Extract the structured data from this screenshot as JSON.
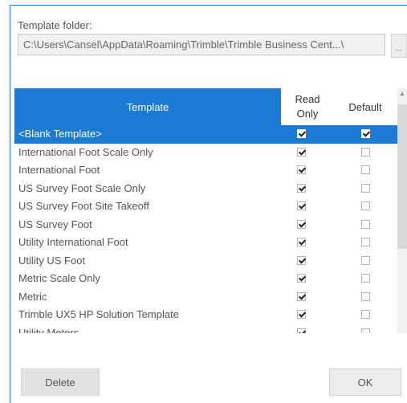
{
  "template_folder": {
    "label": "Template folder:",
    "path": "C:\\Users\\Cansel\\AppData\\Roaming\\Trimble\\Trimble  Business  Cent...\\",
    "browse_label": "..."
  },
  "grid": {
    "columns": {
      "template": "Template",
      "read_only": "Read\nOnly",
      "default": "Default"
    },
    "rows": [
      {
        "name": "<Blank Template>",
        "read_only": true,
        "default": true,
        "selected": true
      },
      {
        "name": "International Foot Scale Only",
        "read_only": true,
        "default": false
      },
      {
        "name": "International Foot",
        "read_only": true,
        "default": false
      },
      {
        "name": "US Survey Foot Scale Only",
        "read_only": true,
        "default": false
      },
      {
        "name": "US Survey Foot Site Takeoff",
        "read_only": true,
        "default": false
      },
      {
        "name": "US Survey Foot",
        "read_only": true,
        "default": false
      },
      {
        "name": "Utility International Foot",
        "read_only": true,
        "default": false
      },
      {
        "name": "Utility US Foot",
        "read_only": true,
        "default": false
      },
      {
        "name": "Metric Scale Only",
        "read_only": true,
        "default": false
      },
      {
        "name": "Metric",
        "read_only": true,
        "default": false
      },
      {
        "name": "Trimble UX5 HP Solution Template",
        "read_only": true,
        "default": false
      },
      {
        "name": "Utility Meters",
        "read_only": true,
        "default": false
      }
    ]
  },
  "buttons": {
    "delete": "Delete",
    "ok": "OK"
  },
  "colors": {
    "selection": "#1a7ad4",
    "frame": "#2a7fd6"
  },
  "icons": {
    "scroll_up": "chevron-up-icon"
  }
}
